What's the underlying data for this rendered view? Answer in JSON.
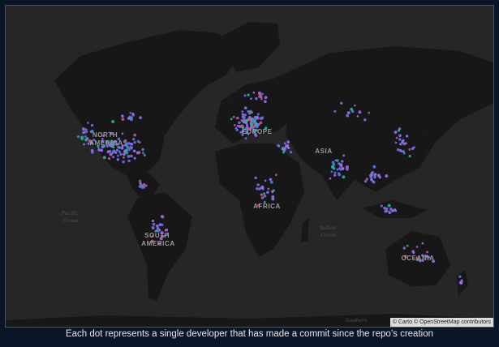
{
  "map": {
    "continent_labels": [
      {
        "id": "north-america",
        "lines": [
          "NORTH",
          "AMERICA"
        ]
      },
      {
        "id": "south-america",
        "lines": [
          "SOUTH",
          "AMERICA"
        ]
      },
      {
        "id": "europe",
        "lines": [
          "EUROPE"
        ]
      },
      {
        "id": "africa",
        "lines": [
          "AFRICA"
        ]
      },
      {
        "id": "asia",
        "lines": [
          "ASIA"
        ]
      },
      {
        "id": "oceania",
        "lines": [
          "OCEANIA"
        ]
      }
    ],
    "ocean_labels": [
      {
        "id": "pacific",
        "lines": [
          "Pacific",
          "Ocean"
        ]
      },
      {
        "id": "indian",
        "lines": [
          "Indian",
          "Ocean"
        ]
      },
      {
        "id": "southern",
        "lines": [
          "Southern"
        ]
      }
    ],
    "attribution": "© Carto © OpenStreetMap contributors",
    "colors": {
      "background": "#0a1628",
      "ocean": "#262626",
      "land": "#171717",
      "dot_primary": "#9b6cf2",
      "dot_secondary": "#5d73e8",
      "dot_tertiary": "#22b59a",
      "dot_quaternary": "#c8567a"
    }
  },
  "caption": "Each dot represents a single developer that has made a commit since the repo’s creation"
}
